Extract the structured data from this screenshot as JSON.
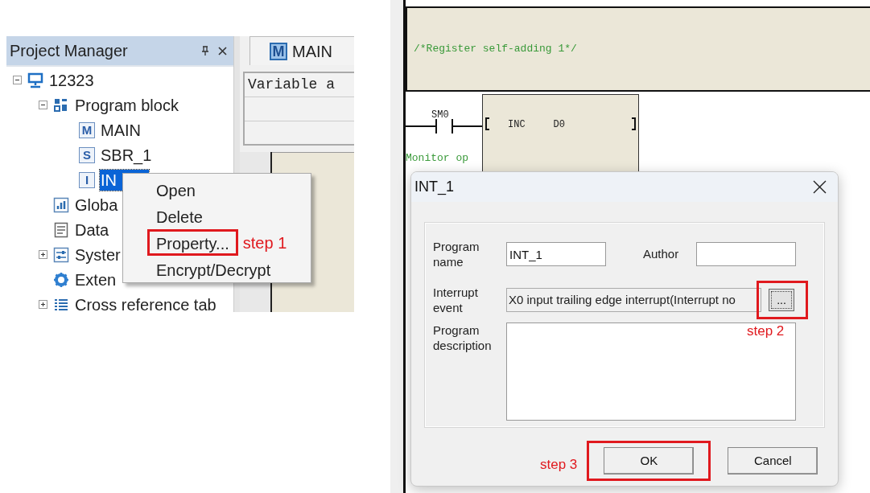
{
  "project_manager": {
    "title": "Project Manager",
    "tree": [
      {
        "label": "12323",
        "kind": "computer",
        "expanded": true,
        "selected": false,
        "children": [
          {
            "label": "Program block",
            "kind": "blocks",
            "expanded": true,
            "selected": false,
            "children": [
              {
                "label": "MAIN",
                "kind": "letter",
                "icon_glyph": "M",
                "selected": false
              },
              {
                "label": "SBR_1",
                "kind": "letter",
                "icon_glyph": "S",
                "selected": false
              },
              {
                "label": "IN",
                "kind": "letter",
                "icon_glyph": "I",
                "selected": true
              }
            ]
          },
          {
            "label": "Globa",
            "kind": "chart",
            "selected": false
          },
          {
            "label": "Data",
            "kind": "doc",
            "selected": false
          },
          {
            "label": "Syster",
            "kind": "sliders",
            "expanded": false,
            "selected": false
          },
          {
            "label": "Exten",
            "kind": "gear",
            "selected": false
          },
          {
            "label": "Cross reference tab",
            "kind": "list",
            "expanded": false,
            "selected": false
          }
        ]
      }
    ]
  },
  "editor_tab": {
    "label": "MAIN",
    "icon_glyph": "M"
  },
  "variable_header": "Variable a",
  "context_menu": [
    {
      "label": "Open"
    },
    {
      "label": "Delete"
    },
    {
      "label": "Property...",
      "annotation": "step 1"
    },
    {
      "label": "Encrypt/Decrypt"
    }
  ],
  "ladder": {
    "comment": "/*Register self-adding 1*/",
    "contact": "SM0",
    "instruction": "INC",
    "operand": "D0",
    "contact_comment": "Monitor op"
  },
  "dialog": {
    "title": "INT_1",
    "program_name": {
      "label": "Program name",
      "value": "INT_1"
    },
    "author": {
      "label": "Author"
    },
    "interrupt_event": {
      "label": "Interrupt event",
      "value": "X0 input trailing edge interrupt(Interrupt no",
      "button": "...",
      "annotation": "step 2"
    },
    "description": {
      "label": "Program description"
    },
    "buttons": [
      {
        "label": "OK",
        "annotation": "step 3"
      },
      {
        "label": "Cancel"
      }
    ]
  }
}
